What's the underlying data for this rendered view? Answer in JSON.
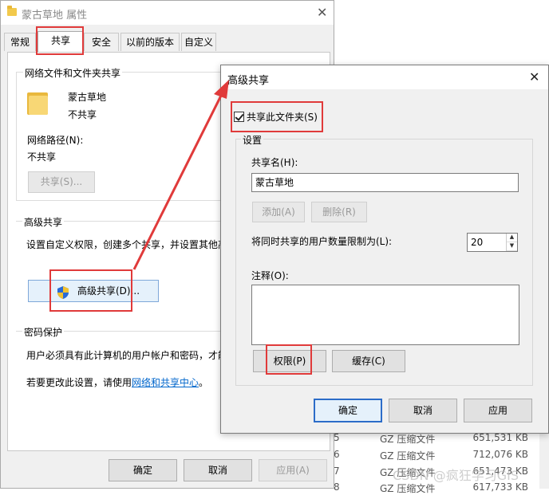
{
  "background_explorer": {
    "rows": [
      {
        "prefix": "5",
        "type": "GZ 压缩文件",
        "size": "651,531 KB"
      },
      {
        "prefix": "6",
        "type": "GZ 压缩文件",
        "size": "712,076 KB"
      },
      {
        "prefix": "7",
        "type": "GZ 压缩文件",
        "size": "651,473 KB"
      },
      {
        "prefix": "8",
        "type": "GZ 压缩文件",
        "size": "617,733 KB"
      }
    ]
  },
  "properties_window": {
    "title": "蒙古草地 属性",
    "tabs": [
      "常规",
      "共享",
      "安全",
      "以前的版本",
      "自定义"
    ],
    "active_tab": "共享",
    "network_sharing": {
      "group_title": "网络文件和文件夹共享",
      "folder_name": "蒙古草地",
      "share_status": "不共享",
      "network_path_label": "网络路径(N):",
      "network_path_value": "不共享",
      "share_button": "共享(S)..."
    },
    "advanced_sharing": {
      "group_title": "高级共享",
      "description": "设置自定义权限，创建多个共享，并设置其他高级共享选项。",
      "button": "高级共享(D)..."
    },
    "password_protection": {
      "group_title": "密码保护",
      "description": "用户必须具有此计算机的用户帐户和密码，才能访问共享文件夹。",
      "change_prefix": "若要更改此设置，请使用",
      "link": "网络和共享中心",
      "change_suffix": "。"
    },
    "buttons": {
      "ok": "确定",
      "cancel": "取消",
      "apply": "应用(A)"
    }
  },
  "advanced_dialog": {
    "title": "高级共享",
    "share_checkbox_label": "共享此文件夹(S)",
    "share_checked": true,
    "settings_group": "设置",
    "share_name_label": "共享名(H):",
    "share_name_value": "蒙古草地",
    "add_button": "添加(A)",
    "remove_button": "删除(R)",
    "user_limit_label": "将同时共享的用户数量限制为(L):",
    "user_limit_value": "20",
    "comment_label": "注释(O):",
    "comment_value": "",
    "permissions_button": "权限(P)",
    "caching_button": "缓存(C)",
    "ok": "确定",
    "cancel": "取消",
    "apply": "应用"
  },
  "annotation_color": "#e03a3a",
  "watermark": "CSDN @疯狂学习GIS"
}
